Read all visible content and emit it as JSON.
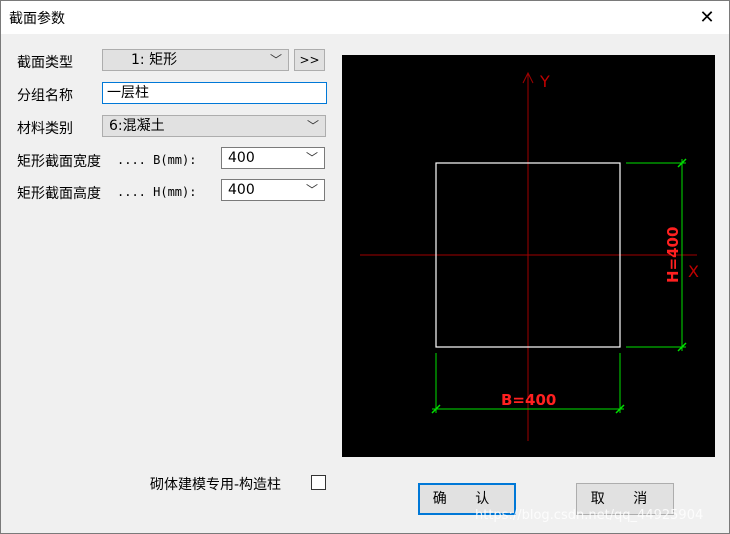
{
  "window": {
    "title": "截面参数",
    "close_icon": "close-icon"
  },
  "form": {
    "section_type_label": "截面类型",
    "section_type_value": "1: 矩形",
    "more_button": ">>",
    "group_name_label": "分组名称",
    "group_name_value": "一层柱",
    "material_label": "材料类别",
    "material_value": "6:混凝土",
    "width_label": "矩形截面宽度",
    "width_unit": ".... B(mm):",
    "width_value": "400",
    "height_label": "矩形截面高度",
    "height_unit": ".... H(mm):",
    "height_value": "400"
  },
  "preview": {
    "y_axis": "Y",
    "x_axis": "X",
    "b_dim": "B=400",
    "h_dim": "H=400",
    "colors": {
      "background": "#000000",
      "axis": "#8b0000",
      "dim": "#00ff00",
      "text": "#ff2020",
      "shape": "#ffffff"
    }
  },
  "footer": {
    "masonry_checkbox_label": "砌体建模专用-构造柱",
    "masonry_checked": false,
    "ok": "确 认",
    "cancel": "取 消",
    "watermark": "https://blog.csdn.net/qq_44925904"
  }
}
